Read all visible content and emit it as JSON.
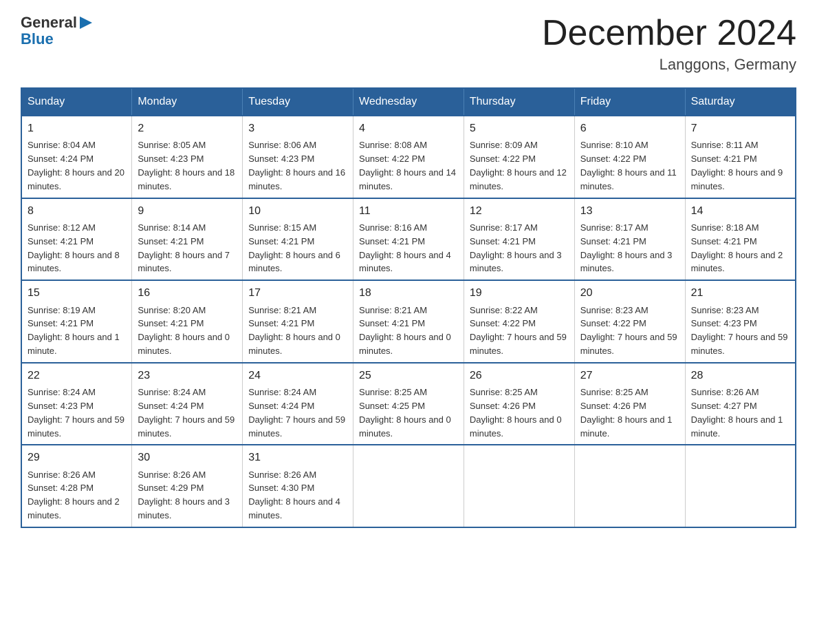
{
  "header": {
    "logo_general": "General",
    "logo_blue": "Blue",
    "title": "December 2024",
    "location": "Langgons, Germany"
  },
  "days_of_week": [
    "Sunday",
    "Monday",
    "Tuesday",
    "Wednesday",
    "Thursday",
    "Friday",
    "Saturday"
  ],
  "weeks": [
    [
      {
        "num": "1",
        "sunrise": "8:04 AM",
        "sunset": "4:24 PM",
        "daylight": "8 hours and 20 minutes."
      },
      {
        "num": "2",
        "sunrise": "8:05 AM",
        "sunset": "4:23 PM",
        "daylight": "8 hours and 18 minutes."
      },
      {
        "num": "3",
        "sunrise": "8:06 AM",
        "sunset": "4:23 PM",
        "daylight": "8 hours and 16 minutes."
      },
      {
        "num": "4",
        "sunrise": "8:08 AM",
        "sunset": "4:22 PM",
        "daylight": "8 hours and 14 minutes."
      },
      {
        "num": "5",
        "sunrise": "8:09 AM",
        "sunset": "4:22 PM",
        "daylight": "8 hours and 12 minutes."
      },
      {
        "num": "6",
        "sunrise": "8:10 AM",
        "sunset": "4:22 PM",
        "daylight": "8 hours and 11 minutes."
      },
      {
        "num": "7",
        "sunrise": "8:11 AM",
        "sunset": "4:21 PM",
        "daylight": "8 hours and 9 minutes."
      }
    ],
    [
      {
        "num": "8",
        "sunrise": "8:12 AM",
        "sunset": "4:21 PM",
        "daylight": "8 hours and 8 minutes."
      },
      {
        "num": "9",
        "sunrise": "8:14 AM",
        "sunset": "4:21 PM",
        "daylight": "8 hours and 7 minutes."
      },
      {
        "num": "10",
        "sunrise": "8:15 AM",
        "sunset": "4:21 PM",
        "daylight": "8 hours and 6 minutes."
      },
      {
        "num": "11",
        "sunrise": "8:16 AM",
        "sunset": "4:21 PM",
        "daylight": "8 hours and 4 minutes."
      },
      {
        "num": "12",
        "sunrise": "8:17 AM",
        "sunset": "4:21 PM",
        "daylight": "8 hours and 3 minutes."
      },
      {
        "num": "13",
        "sunrise": "8:17 AM",
        "sunset": "4:21 PM",
        "daylight": "8 hours and 3 minutes."
      },
      {
        "num": "14",
        "sunrise": "8:18 AM",
        "sunset": "4:21 PM",
        "daylight": "8 hours and 2 minutes."
      }
    ],
    [
      {
        "num": "15",
        "sunrise": "8:19 AM",
        "sunset": "4:21 PM",
        "daylight": "8 hours and 1 minute."
      },
      {
        "num": "16",
        "sunrise": "8:20 AM",
        "sunset": "4:21 PM",
        "daylight": "8 hours and 0 minutes."
      },
      {
        "num": "17",
        "sunrise": "8:21 AM",
        "sunset": "4:21 PM",
        "daylight": "8 hours and 0 minutes."
      },
      {
        "num": "18",
        "sunrise": "8:21 AM",
        "sunset": "4:21 PM",
        "daylight": "8 hours and 0 minutes."
      },
      {
        "num": "19",
        "sunrise": "8:22 AM",
        "sunset": "4:22 PM",
        "daylight": "7 hours and 59 minutes."
      },
      {
        "num": "20",
        "sunrise": "8:23 AM",
        "sunset": "4:22 PM",
        "daylight": "7 hours and 59 minutes."
      },
      {
        "num": "21",
        "sunrise": "8:23 AM",
        "sunset": "4:23 PM",
        "daylight": "7 hours and 59 minutes."
      }
    ],
    [
      {
        "num": "22",
        "sunrise": "8:24 AM",
        "sunset": "4:23 PM",
        "daylight": "7 hours and 59 minutes."
      },
      {
        "num": "23",
        "sunrise": "8:24 AM",
        "sunset": "4:24 PM",
        "daylight": "7 hours and 59 minutes."
      },
      {
        "num": "24",
        "sunrise": "8:24 AM",
        "sunset": "4:24 PM",
        "daylight": "7 hours and 59 minutes."
      },
      {
        "num": "25",
        "sunrise": "8:25 AM",
        "sunset": "4:25 PM",
        "daylight": "8 hours and 0 minutes."
      },
      {
        "num": "26",
        "sunrise": "8:25 AM",
        "sunset": "4:26 PM",
        "daylight": "8 hours and 0 minutes."
      },
      {
        "num": "27",
        "sunrise": "8:25 AM",
        "sunset": "4:26 PM",
        "daylight": "8 hours and 1 minute."
      },
      {
        "num": "28",
        "sunrise": "8:26 AM",
        "sunset": "4:27 PM",
        "daylight": "8 hours and 1 minute."
      }
    ],
    [
      {
        "num": "29",
        "sunrise": "8:26 AM",
        "sunset": "4:28 PM",
        "daylight": "8 hours and 2 minutes."
      },
      {
        "num": "30",
        "sunrise": "8:26 AM",
        "sunset": "4:29 PM",
        "daylight": "8 hours and 3 minutes."
      },
      {
        "num": "31",
        "sunrise": "8:26 AM",
        "sunset": "4:30 PM",
        "daylight": "8 hours and 4 minutes."
      },
      null,
      null,
      null,
      null
    ]
  ]
}
